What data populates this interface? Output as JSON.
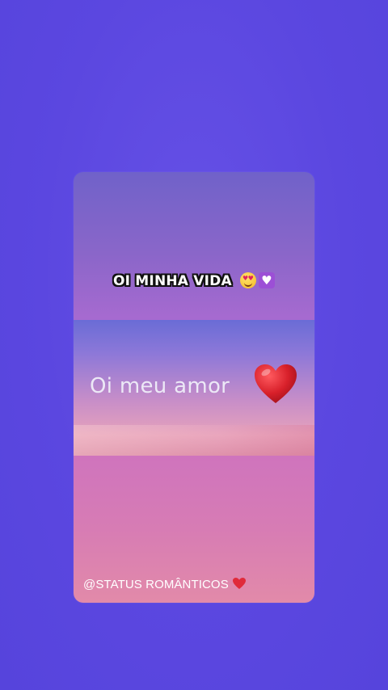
{
  "story": {
    "top_caption": "OI MINHA VIDA",
    "top_caption_emojis": [
      "smiling-face-with-heart-eyes",
      "white-heart-purple-box"
    ],
    "main_text": "Oi meu amor",
    "main_text_emoji": "red-heart",
    "handle": "@STATUS ROMÂNTICOS",
    "handle_emoji": "red-heart"
  },
  "colors": {
    "background": "#5b47e0",
    "heart": "#d8202a",
    "sky_top": "#7062c9",
    "sky_bottom": "#e28aa9"
  }
}
